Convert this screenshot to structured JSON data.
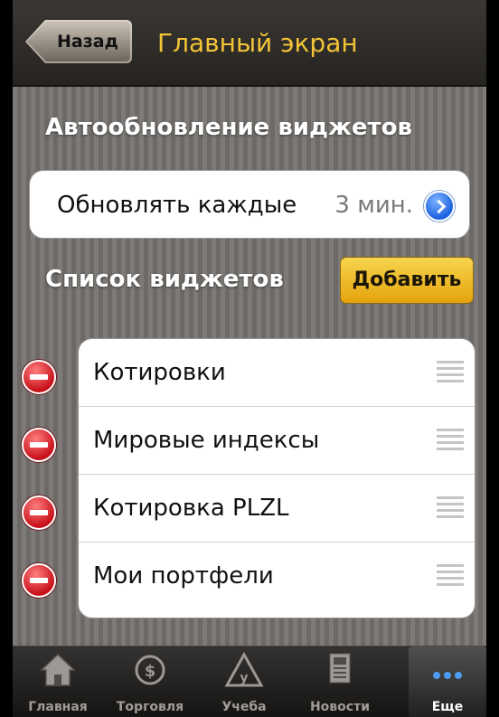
{
  "navbar": {
    "back_label": "Назад",
    "title": "Главный экран"
  },
  "auto_update": {
    "section_title": "Автообновление виджетов",
    "row_label": "Обновлять каждые",
    "row_value": "3 мин.",
    "disclosure_icon": "chevron-right-circle-icon"
  },
  "widgets": {
    "section_title": "Список виджетов",
    "add_label": "Добавить",
    "items": [
      {
        "label": "Котировки"
      },
      {
        "label": "Мировые индексы"
      },
      {
        "label": "Котировка PLZL"
      },
      {
        "label": "Мои портфели"
      }
    ]
  },
  "tabbar": {
    "tabs": [
      {
        "label": "Главная",
        "icon": "home-icon"
      },
      {
        "label": "Торговля",
        "icon": "trading-icon"
      },
      {
        "label": "Учеба",
        "icon": "study-icon"
      },
      {
        "label": "Новости",
        "icon": "news-icon"
      },
      {
        "label": "Еще",
        "icon": "more-icon",
        "active": true
      }
    ]
  },
  "colors": {
    "title_accent": "#f4c437",
    "add_button": "#f0bf2a",
    "delete": "#c8101a",
    "disclosure": "#1c62e0"
  }
}
